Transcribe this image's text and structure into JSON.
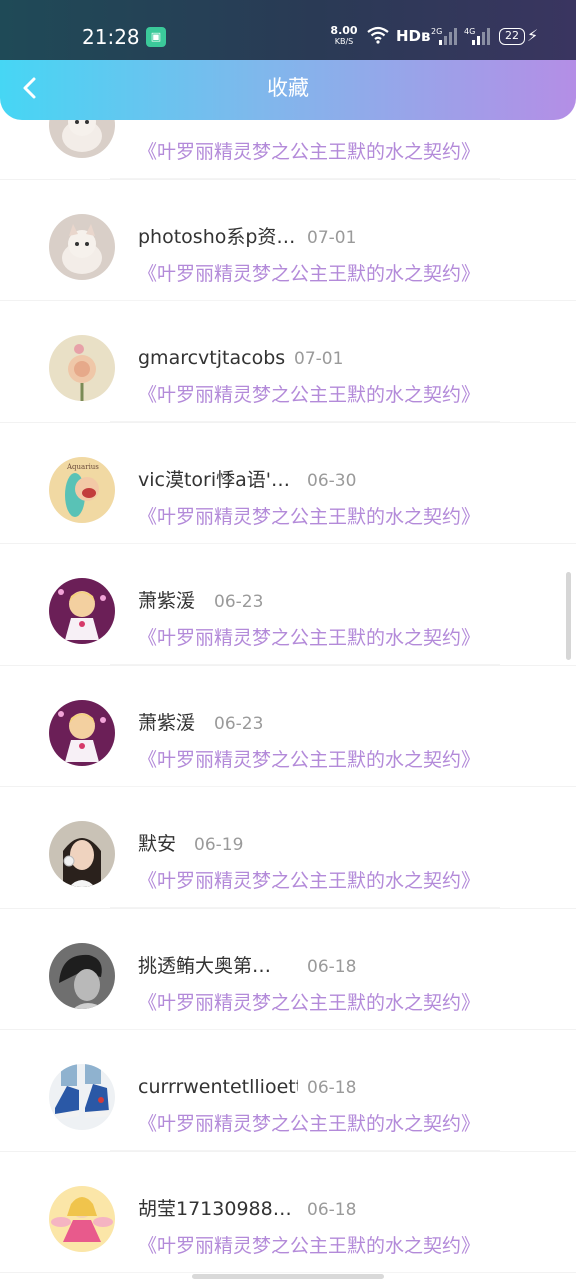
{
  "status_bar": {
    "time": "21:28",
    "net_speed_value": "8.00",
    "net_speed_unit": "KB/S",
    "hd_label": "HDʙ",
    "sig1_label": "2G",
    "sig2_label": "4G",
    "battery": "22",
    "app_badge_icon": "app-notification-icon"
  },
  "header": {
    "title": "收藏",
    "back_icon": "back-arrow-icon",
    "gradient_colors": [
      "#46d6f4",
      "#b48ee6"
    ]
  },
  "accent": {
    "book_color": "#b38ad9",
    "name_color": "#333333",
    "date_color": "#9a9a9a"
  },
  "favorites": [
    {
      "name": "",
      "date": "",
      "book": "《叶罗丽精灵梦之公主王默的水之契约》",
      "avatar": "avatar-cat-icon"
    },
    {
      "name": "photosho系p资…",
      "date": "07-01",
      "book": "《叶罗丽精灵梦之公主王默的水之契约》",
      "avatar": "avatar-cat-icon"
    },
    {
      "name": "gmarcvtjtacobs",
      "date": "07-01",
      "book": "《叶罗丽精灵梦之公主王默的水之契约》",
      "avatar": "avatar-rose-icon"
    },
    {
      "name": "vic漠tori悸a语'…",
      "date": "06-30",
      "book": "《叶罗丽精灵梦之公主王默的水之契约》",
      "avatar": "avatar-cartoon-girl-icon"
    },
    {
      "name": "萧紫湲",
      "date": "06-23",
      "book": "《叶罗丽精灵梦之公主王默的水之契约》",
      "avatar": "avatar-anime-princess-icon"
    },
    {
      "name": "萧紫湲",
      "date": "06-23",
      "book": "《叶罗丽精灵梦之公主王默的水之契约》",
      "avatar": "avatar-anime-princess-icon"
    },
    {
      "name": "默安",
      "date": "06-19",
      "book": "《叶罗丽精灵梦之公主王默的水之契约》",
      "avatar": "avatar-photo-girl-icon"
    },
    {
      "name": "挑透鲔大奥第…",
      "date": "06-18",
      "book": "《叶罗丽精灵梦之公主王默的水之契约》",
      "avatar": "avatar-bw-portrait-icon"
    },
    {
      "name": "currrwentetllioett",
      "date": "06-18",
      "book": "《叶罗丽精灵梦之公主王默的水之契约》",
      "avatar": "avatar-sneakers-icon"
    },
    {
      "name": "胡莹17130988…",
      "date": "06-18",
      "book": "《叶罗丽精灵梦之公主王默的水之契约》",
      "avatar": "avatar-fairy-icon"
    }
  ]
}
